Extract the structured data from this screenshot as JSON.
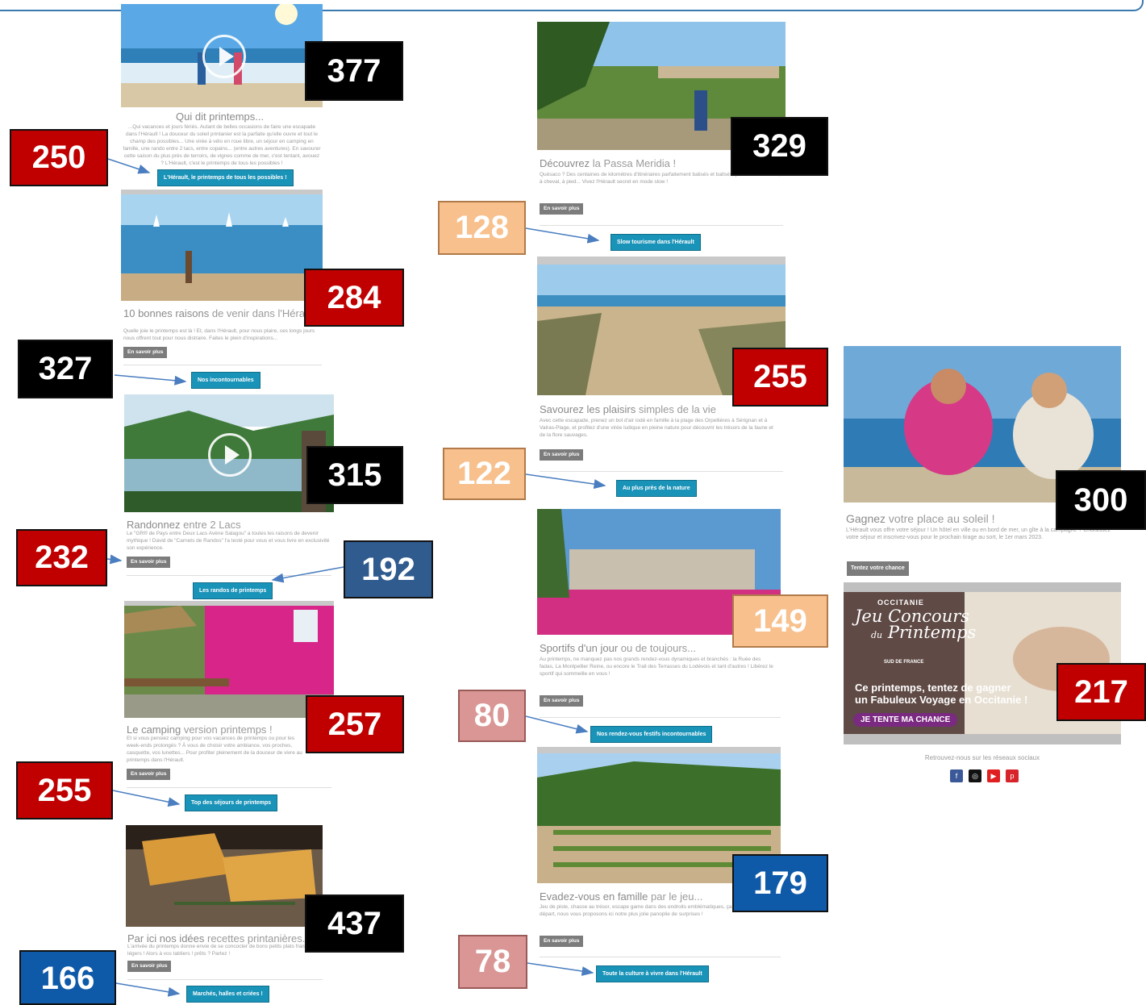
{
  "columns": {
    "left": [
      {
        "title": "Qui dit printemps...",
        "desc": "...Qui vacances et jours fériés. Autant de belles occasions de faire une escapade dans l'Hérault ! La douceur du soleil printanier est la parfaite qu'elle ouvre et tout le champ des possibles... Une virée à vélo en roue libre, un séjour en camping en famille, une rando entre 2 lacs, entre copains... (entre autres aventures). En savourer cette saison du plus près de terroirs, de vignes comme de mer, c'est tentant, avouez ? L'Hérault, c'est le printemps de tous les possibles !",
        "button": "",
        "cta": "L'Hérault, le printemps de tous les possibles !"
      },
      {
        "title_main": "10 bonnes raisons",
        "title_light": " de venir dans l'Hérault au printemps",
        "desc": "Quelle joie le printemps est là ! Et, dans l'Hérault, pour nous plaire, ces longs jours nous offrent tout pour nous distraire. Faites le plein d'inspirations...",
        "button": "En savoir plus",
        "cta": "Nos incontournables"
      },
      {
        "title_main": "Randonnez",
        "title_light": " entre 2 Lacs",
        "desc": "Le \"GR® de Pays entre Deux Lacs Avène Salagou\" a toutes les raisons de devenir mythique ! David de \"Carnets de Randos\" l'a testé pour vous et vous livre en exclusivité son expérience.",
        "button": "En savoir plus",
        "cta": "Les randos de printemps"
      },
      {
        "title_main": "Le camping",
        "title_light": " version printemps !",
        "desc": "Et si vous pensiez camping pour vos vacances de printemps ou pour les week-ends prolongés ? À vous de choisir votre ambiance, vos proches, casquette, vos lunettes... Pour profiter pleinement de la douceur de vivre au printemps dans l'Hérault.",
        "button": "En savoir plus",
        "cta": "Top des séjours de printemps"
      },
      {
        "title_main": "Par ici nos idées",
        "title_light": " recettes printanières...",
        "desc": "L'arrivée du printemps donne envie de se concocter de bons petits plats frais et légers ! Alors à vos tabliers ! prêts ? Partez !",
        "button": "En savoir plus",
        "cta": "Marchés, halles et criées !"
      }
    ],
    "middle": [
      {
        "title_main": "Découvrez",
        "title_light": " la Passa Meridia !",
        "desc": "Quésaco ? Des centaines de kilomètres d'itinéraires parfaitement balisés et ballsés, praticables en VTT, à cheval, à pied... Vivez l'Hérault secret en mode slow !",
        "button": "En savoir plus",
        "cta": "Slow tourisme dans l'Hérault"
      },
      {
        "title_main": "Savourez les plaisirs",
        "title_light": " simples de la vie",
        "desc": "Avec cette escapade, prenez un bol d'air iodé en famille à la plage des Orpellières à Sérignan et à Valras-Plage, et profitez d'une virée ludique en pleine nature pour découvrir les trésors de la faune et de la flore sauvages.",
        "button": "En savoir plus",
        "cta": "Au plus près de la nature"
      },
      {
        "title_main": "Sportifs d'un jour",
        "title_light": " ou de toujours...",
        "desc": "Au printemps, ne manquez pas nos grands rendez-vous dynamiques et branchés : la Ruée des fadas, La Montpellier Reine, ou encore le Trail des Terrasses du Lodévois et tant d'autres ! Libérez le sportif qui sommeille en vous !",
        "button": "En savoir plus",
        "cta": "Nos rendez-vous festifs incontournables"
      },
      {
        "title_main": "Evadez-vous en famille",
        "title_light": " par le jeu...",
        "desc": "Jeu de piste, chasse au trésor, escape game dans des endroits emblématiques, ça vous tente ? Top départ, nous vous proposons ici notre plus jolie panoplie de surprises !",
        "button": "En savoir plus",
        "cta": "Toute la culture à vivre dans l'Hérault"
      }
    ],
    "right": {
      "title_main": "Gagnez",
      "title_light": " votre place au soleil !",
      "desc": "L'Hérault vous offre votre séjour ! Un hôtel en ville ou en bord de mer, un gîte à la campagne ? Choisissez votre séjour et inscrivez-vous pour le prochain tirage au sort, le 1er mars 2023.",
      "button": "Tentez votre chance",
      "banner": {
        "seal_top": "OCCITANIE",
        "seal_line1": "Jeu",
        "seal_line2": "Concours",
        "seal_line3": "du",
        "seal_line4": "Printemps",
        "seal_bottom": "SUD DE FRANCE",
        "headline1": "Ce printemps, tentez de gagner",
        "headline2": "un Fabuleux Voyage en Occitanie !",
        "cta": "JE TENTE MA CHANCE"
      },
      "social_label": "Retrouvez-nous sur les réseaux sociaux",
      "social": [
        "facebook-icon",
        "instagram-icon",
        "youtube-icon",
        "pinterest-icon"
      ]
    }
  },
  "badges": {
    "b377": "377",
    "b250": "250",
    "b284": "284",
    "b327": "327",
    "b315": "315",
    "b232": "232",
    "b192": "192",
    "b257": "257",
    "b255a": "255",
    "b437": "437",
    "b166": "166",
    "b329": "329",
    "b128": "128",
    "b255b": "255",
    "b122": "122",
    "b149": "149",
    "b80": "80",
    "b179": "179",
    "b78": "78",
    "b300": "300",
    "b217": "217"
  },
  "colors": {
    "black": "#000000",
    "red": "#c00000",
    "blue": "#0f5aa8",
    "navy": "#2f5b8e",
    "peach": "#f7c08d",
    "pink": "#d99694",
    "cta": "#1a93b8"
  }
}
